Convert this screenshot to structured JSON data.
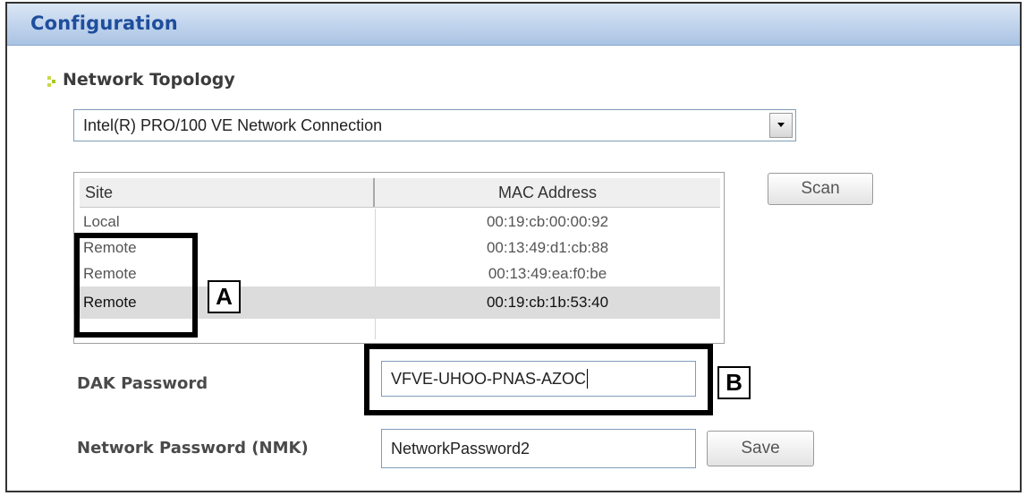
{
  "window": {
    "title": "Configuration"
  },
  "network_topology": {
    "heading": "Network Topology",
    "adapter_select": {
      "selected": "Intel(R) PRO/100 VE Network Connection"
    }
  },
  "device_table": {
    "columns": [
      "Site",
      "MAC Address"
    ],
    "rows": [
      {
        "site": "Local",
        "mac": "00:19:cb:00:00:92"
      },
      {
        "site": "Remote",
        "mac": "00:13:49:d1:cb:88"
      },
      {
        "site": "Remote",
        "mac": "00:13:49:ea:f0:be"
      },
      {
        "site": "Remote",
        "mac": "00:19:cb:1b:53:40",
        "selected": true
      }
    ]
  },
  "buttons": {
    "scan": "Scan",
    "save": "Save"
  },
  "dak": {
    "label": "DAK Password",
    "value": "VFVE-UHOO-PNAS-AZOC"
  },
  "nmk": {
    "label": "Network Password (NMK)",
    "value": "NetworkPassword2"
  },
  "annotations": {
    "a": "A",
    "b": "B"
  },
  "colors": {
    "title": "#1e4e9c",
    "titlebar": "#c4d6ee",
    "bullet": "#a8c820",
    "selected_row": "#dcdcdc"
  },
  "icons": {
    "section_bullet": "bullet-arrow-icon",
    "dropdown": "chevron-down-icon"
  }
}
